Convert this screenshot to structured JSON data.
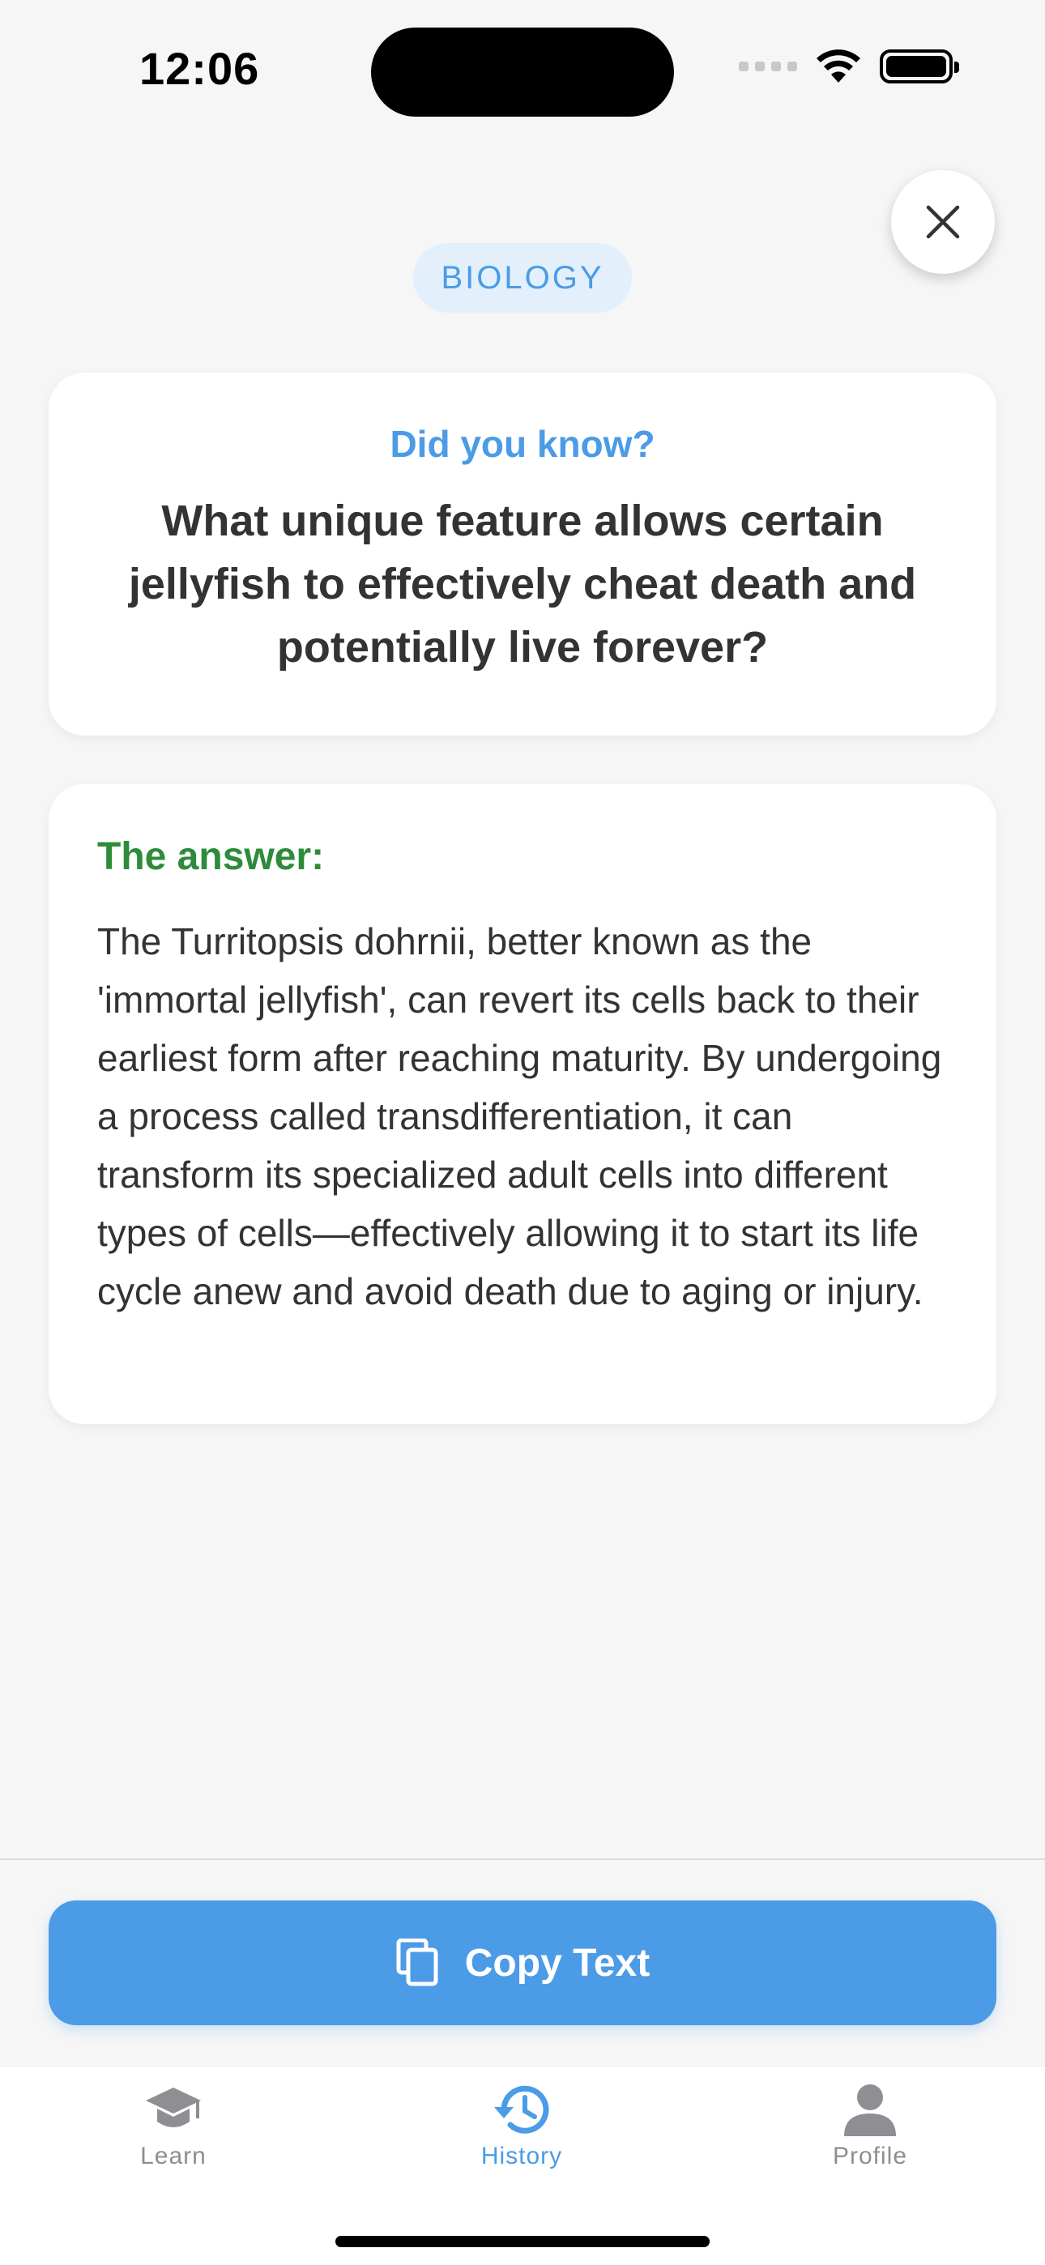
{
  "status_bar": {
    "time": "12:06"
  },
  "category": {
    "label": "BIOLOGY"
  },
  "question_card": {
    "heading": "Did you know?",
    "question": "What unique feature allows certain jellyfish to effectively cheat death and potentially live forever?"
  },
  "answer_card": {
    "heading": "The answer:",
    "text": "The Turritopsis dohrnii, better known as the 'immortal jellyfish', can revert its cells back to their earliest form after reaching maturity. By undergoing a process called transdifferentiation, it can transform its specialized adult cells into different types of cells—effectively allowing it to start its life cycle anew and avoid death due to aging or injury."
  },
  "actions": {
    "copy_label": "Copy Text"
  },
  "tab_bar": {
    "tabs": [
      {
        "label": "Learn",
        "icon": "graduation-cap-icon",
        "active": false
      },
      {
        "label": "History",
        "icon": "history-icon",
        "active": true
      },
      {
        "label": "Profile",
        "icon": "person-icon",
        "active": false
      }
    ]
  },
  "colors": {
    "accent": "#4b9be6",
    "answer_green": "#2e8b3a",
    "inactive_tab": "#8e8e93",
    "background": "#f6f6f7"
  }
}
